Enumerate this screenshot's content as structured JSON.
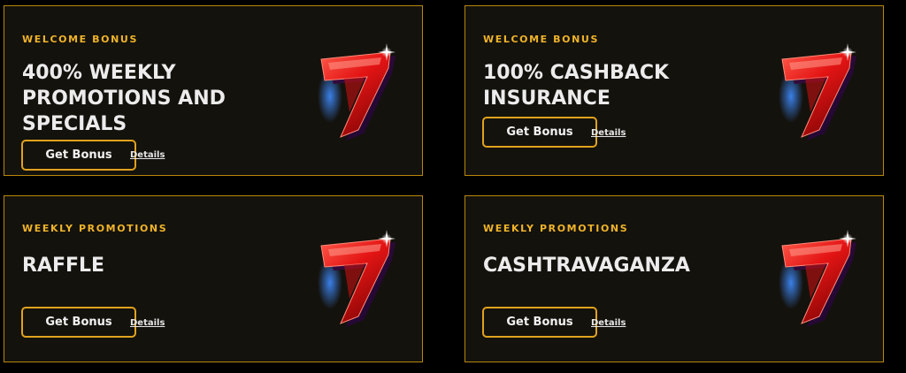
{
  "promotions": [
    {
      "tag": "WELCOME BONUS",
      "title": "400% WEEKLY PROMOTIONS AND SPECIALS",
      "button": "Get Bonus",
      "link": "Details",
      "icon": "lucky-seven-icon"
    },
    {
      "tag": "WELCOME BONUS",
      "title": "100% CASHBACK INSURANCE",
      "button": "Get Bonus",
      "link": "Details",
      "icon": "lucky-seven-icon"
    },
    {
      "tag": "WEEKLY PROMOTIONS",
      "title": "RAFFLE",
      "button": "Get Bonus",
      "link": "Details",
      "icon": "lucky-seven-icon"
    },
    {
      "tag": "WEEKLY PROMOTIONS",
      "title": "CASHTRAVAGANZA",
      "button": "Get Bonus",
      "link": "Details",
      "icon": "lucky-seven-icon"
    }
  ],
  "colors": {
    "background": "#000000",
    "card_background": "#14120d",
    "card_border": "#b8860b",
    "accent": "#f0b429",
    "seven_red": "#e01818",
    "seven_glow": "#2a7de1"
  }
}
